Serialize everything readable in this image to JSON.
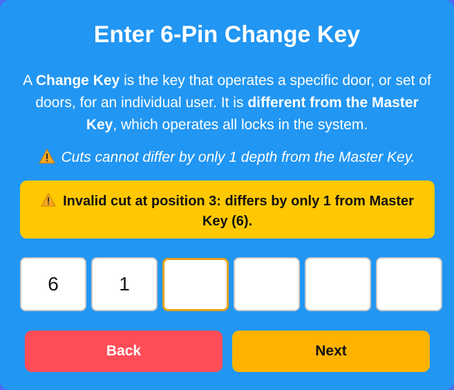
{
  "dialog": {
    "title": "Enter 6-Pin Change Key",
    "description": {
      "p1": "A ",
      "b1": "Change Key",
      "p2": " is the key that operates a specific door, or set of doors, for an individual user. It is ",
      "b2": "different from the Master Key",
      "p3": ", which operates all locks in the system."
    },
    "note": "Cuts cannot differ by only 1 depth from the Master Key.",
    "alert": "Invalid cut at position 3: differs by only 1 from Master Key (6).",
    "pins": [
      "6",
      "1",
      "",
      "",
      "",
      ""
    ],
    "active_pin": 3,
    "back_label": "Back",
    "next_label": "Next"
  },
  "colors": {
    "panel_bg": "#2196f3",
    "alert_bg": "#ffc800",
    "back_bg": "#ff4d58",
    "next_bg": "#ffb300",
    "active_border": "#e6a11a"
  },
  "icons": {
    "warning": "warning-triangle-icon"
  }
}
